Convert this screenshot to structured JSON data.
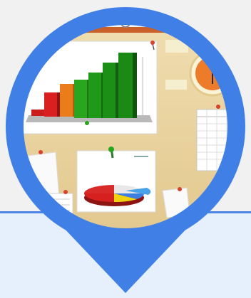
{
  "illustration": {
    "subject": "office-bulletin-board",
    "pin_icon": "map-pin-marker",
    "colors": {
      "pin_ring": "#3f7fe6",
      "panel_fill": "#e6f0fc",
      "panel_border": "#4b86e6",
      "page_background": "#f1f1f1",
      "board": "#e9d3a1",
      "board_frame": "#c9602a"
    },
    "bar_chart_icon": "bar-chart-icon",
    "pie_chart_icon": "pie-chart-icon",
    "clock_icon": "clock-icon",
    "spreadsheet_icon": "spreadsheet-icon"
  }
}
